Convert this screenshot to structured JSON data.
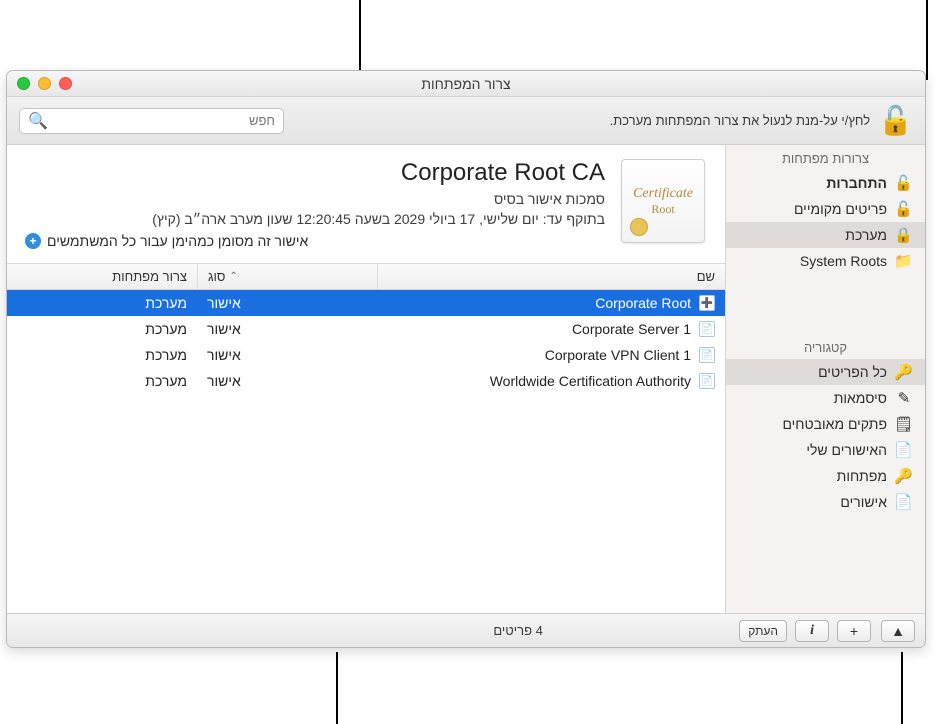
{
  "window": {
    "title": "צרור המפתחות",
    "lock_text": "לחץ/י על-מנת לנעול את צרור המפתחות מערכת.",
    "search_placeholder": "חפש"
  },
  "sidebar": {
    "header_keychains": "צרורות מפתחות",
    "header_category": "קטגוריה",
    "keychains": [
      {
        "label": "התחברות",
        "icon": "🔓",
        "selected": false,
        "bold": true
      },
      {
        "label": "פריטים מקומיים",
        "icon": "🔓",
        "selected": false
      },
      {
        "label": "מערכת",
        "icon": "🔒",
        "selected": true
      },
      {
        "label": "System Roots",
        "icon": "📁",
        "selected": false,
        "ltr": true
      }
    ],
    "categories": [
      {
        "label": "כל הפריטים",
        "icon": "🔑",
        "selected": true
      },
      {
        "label": "סיסמאות",
        "icon": "✎",
        "selected": false
      },
      {
        "label": "פתקים מאובטחים",
        "icon": "🗒",
        "selected": false
      },
      {
        "label": "האישורים שלי",
        "icon": "📄",
        "selected": false
      },
      {
        "label": "מפתחות",
        "icon": "🔑",
        "selected": false
      },
      {
        "label": "אישורים",
        "icon": "📄",
        "selected": false
      }
    ]
  },
  "detail": {
    "title": "Corporate Root CA",
    "subtitle": "סמכות אישור בסיס",
    "expiry": "בתוקף עד: יום שלישי, 17 ביולי 2029 בשעה 12:20:45 שעון מערב ארה״ב (קיץ)",
    "trust": "אישור זה מסומן כמהימן עבור כל המשתמשים",
    "trust_mark": "+",
    "thumb_script": "Certificate",
    "thumb_root": "Root"
  },
  "table": {
    "headers": {
      "name": "שם",
      "kind": "סוג",
      "keychain": "צרור מפתחות"
    },
    "rows": [
      {
        "name": "Corporate Root",
        "kind": "אישור",
        "keychain": "מערכת",
        "selected": true,
        "root": true
      },
      {
        "name": "Corporate Server 1",
        "kind": "אישור",
        "keychain": "מערכת",
        "selected": false
      },
      {
        "name": "Corporate VPN Client 1",
        "kind": "אישור",
        "keychain": "מערכת",
        "selected": false
      },
      {
        "name": "Worldwide Certification Authority",
        "kind": "אישור",
        "keychain": "מערכת",
        "selected": false
      }
    ]
  },
  "statusbar": {
    "count": "4 פריטים",
    "copy_label": "העתק",
    "plus": "+",
    "info": "i",
    "collapse": "▲"
  }
}
